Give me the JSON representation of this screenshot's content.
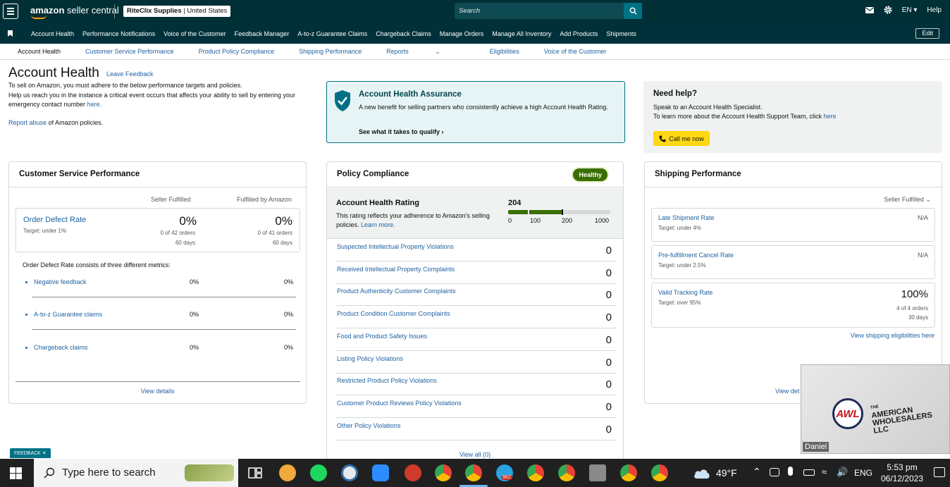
{
  "topbar": {
    "logo_brand": "amazon",
    "logo_product": "seller central",
    "account_name": "RiteClix Supplies",
    "account_region": "United States",
    "search_placeholder": "Search",
    "language": "EN",
    "help": "Help"
  },
  "nav": {
    "items": [
      "Account Health",
      "Performance Notifications",
      "Voice of the Customer",
      "Feedback Manager",
      "A-to-z Guarantee Claims",
      "Chargeback Claims",
      "Manage Orders",
      "Manage All Inventory",
      "Add Products",
      "Shipments"
    ],
    "edit": "Edit"
  },
  "subnav": {
    "items": [
      "Account Health",
      "Customer Service Performance",
      "Product Policy Compliance",
      "Shipping Performance",
      "Reports",
      "Eligibilities",
      "Voice of the Customer"
    ]
  },
  "header": {
    "title": "Account Health",
    "leave_feedback": "Leave Feedback",
    "intro_1": "To sell on Amazon, you must adhere to the below performance targets and policies.",
    "intro_2": "Help us reach you in the instance a critical event occurs that affects your ability to sell by entering your emergency contact number",
    "intro_here": "here.",
    "report_abuse_link": "Report abuse",
    "report_abuse_rest": "of Amazon policies."
  },
  "assurance": {
    "title": "Account Health Assurance",
    "desc": "A new benefit for selling partners who consistently achieve a high Account Health Rating.",
    "link": "See what it takes to qualify"
  },
  "help": {
    "title": "Need help?",
    "line1": "Speak to an Account Health Specialist.",
    "line2": "To learn more about the Account Health Support Team, click",
    "line2_link": "here",
    "call_button": "Call me now"
  },
  "customer_service": {
    "title": "Customer Service Performance",
    "col_seller": "Seller Fulfilled",
    "col_amazon": "Fulfilled by Amazon",
    "odr_name": "Order Defect Rate",
    "odr_target": "Target: under 1%",
    "odr_seller_pct": "0%",
    "odr_seller_orders": "0 of 42 orders",
    "odr_seller_days": "60 days",
    "odr_amazon_pct": "0%",
    "odr_amazon_orders": "0 of 41 orders",
    "odr_amazon_days": "60 days",
    "consists": "Order Defect Rate consists of three different metrics:",
    "metrics": [
      {
        "name": "Negative feedback",
        "seller": "0%",
        "amazon": "0%"
      },
      {
        "name": "A-to-z Guarantee claims",
        "seller": "0%",
        "amazon": "0%"
      },
      {
        "name": "Chargeback claims",
        "seller": "0%",
        "amazon": "0%"
      }
    ],
    "view_details": "View details"
  },
  "policy": {
    "title": "Policy Compliance",
    "status": "Healthy",
    "ahr_title": "Account Health Rating",
    "ahr_desc": "This rating reflects your adherence to Amazon's selling policies.",
    "ahr_learn": "Learn more.",
    "ahr_score": "204",
    "ahr_score_value": 204,
    "ahr_ticks": [
      "0",
      "100",
      "200",
      "1000"
    ],
    "rows": [
      {
        "name": "Suspected Intellectual Property Violations",
        "value": "0"
      },
      {
        "name": "Received Intellectual Property Complaints",
        "value": "0"
      },
      {
        "name": "Product Authenticity Customer Complaints",
        "value": "0"
      },
      {
        "name": "Product Condition Customer Complaints",
        "value": "0"
      },
      {
        "name": "Food and Product Safety Issues",
        "value": "0"
      },
      {
        "name": "Listing Policy Violations",
        "value": "0"
      },
      {
        "name": "Restricted Product Policy Violations",
        "value": "0"
      },
      {
        "name": "Customer Product Reviews Policy Violations",
        "value": "0"
      },
      {
        "name": "Other Policy Violations",
        "value": "0"
      }
    ],
    "view_all": "View all (0)"
  },
  "shipping": {
    "title": "Shipping Performance",
    "filter": "Seller Fulfilled",
    "late_name": "Late Shipment Rate",
    "late_target": "Target: under 4%",
    "late_value": "N/A",
    "cancel_name": "Pre-fulfillment Cancel Rate",
    "cancel_target": "Target: under 2.5%",
    "cancel_value": "N/A",
    "vtr_name": "Valid Tracking Rate",
    "vtr_target": "Target: over 95%",
    "vtr_value": "100%",
    "vtr_orders": "4 of 4 orders",
    "vtr_days": "30 days",
    "eligibilities": "View shipping eligibilities here",
    "view_details": "View det"
  },
  "feedback_tab": "FEEDBACK",
  "video": {
    "participant": "Daniel",
    "logo_initials": "AWL",
    "logo_pre": "THE",
    "logo_line1": "AMERICAN",
    "logo_line2": "WHOLESALERS",
    "logo_line3": "LLC"
  },
  "taskbar": {
    "search_placeholder": "Type here to search",
    "telegram_badge": "962",
    "temperature": "49°F",
    "language": "ENG",
    "time": "5:53 pm",
    "date": "06/12/2023"
  },
  "colors": {
    "topbar": "#002f36",
    "link": "#2162a1",
    "healthy": "#3b6e00",
    "call_button": "#ffd814",
    "assurance_bg": "#e7f4f5"
  }
}
